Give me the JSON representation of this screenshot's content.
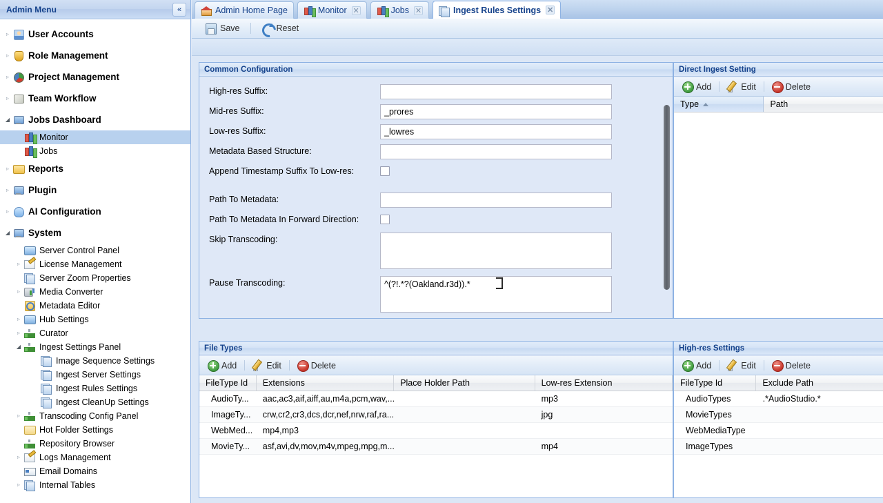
{
  "sidebar": {
    "title": "Admin Menu",
    "collapse_label": "«",
    "items": [
      {
        "label": "User Accounts",
        "icon": "user-icon",
        "level": "top",
        "state": "collapsed"
      },
      {
        "label": "Role Management",
        "icon": "shield-icon",
        "level": "top",
        "state": "collapsed"
      },
      {
        "label": "Project Management",
        "icon": "pie-chart-icon",
        "level": "top",
        "state": "collapsed"
      },
      {
        "label": "Team Workflow",
        "icon": "cube-icon",
        "level": "top",
        "state": "collapsed"
      },
      {
        "label": "Jobs Dashboard",
        "icon": "monitor-icon",
        "level": "top",
        "state": "expanded"
      },
      {
        "label": "Monitor",
        "icon": "bar-chart-icon",
        "level": "child",
        "state": "selected"
      },
      {
        "label": "Jobs",
        "icon": "bar-chart-icon",
        "level": "child",
        "state": "none"
      },
      {
        "label": "Reports",
        "icon": "folder-icon",
        "level": "top",
        "state": "collapsed"
      },
      {
        "label": "Plugin",
        "icon": "monitor-icon",
        "level": "top",
        "state": "collapsed"
      },
      {
        "label": "AI Configuration",
        "icon": "ai-icon",
        "level": "top",
        "state": "collapsed"
      },
      {
        "label": "System",
        "icon": "monitor-icon",
        "level": "top",
        "state": "expanded"
      },
      {
        "label": "Server Control Panel",
        "icon": "screen-icon",
        "level": "child",
        "state": "none"
      },
      {
        "label": "License Management",
        "icon": "pencil-icon",
        "level": "child",
        "state": "collapsed"
      },
      {
        "label": "Server Zoom Properties",
        "icon": "pages-icon",
        "level": "child",
        "state": "none"
      },
      {
        "label": "Media Converter",
        "icon": "drive-icon",
        "level": "child",
        "state": "collapsed"
      },
      {
        "label": "Metadata Editor",
        "icon": "metadata-icon",
        "level": "child",
        "state": "none"
      },
      {
        "label": "Hub Settings",
        "icon": "screen-icon",
        "level": "child",
        "state": "collapsed"
      },
      {
        "label": "Curator",
        "icon": "network-icon",
        "level": "child",
        "state": "collapsed"
      },
      {
        "label": "Ingest Settings Panel",
        "icon": "network-icon",
        "level": "child",
        "state": "expanded"
      },
      {
        "label": "Image Sequence Settings",
        "icon": "pages-icon",
        "level": "grandchild",
        "state": "none"
      },
      {
        "label": "Ingest Server Settings",
        "icon": "pages-icon",
        "level": "grandchild",
        "state": "none"
      },
      {
        "label": "Ingest Rules Settings",
        "icon": "pages-icon",
        "level": "grandchild",
        "state": "none"
      },
      {
        "label": "Ingest CleanUp Settings",
        "icon": "pages-icon",
        "level": "grandchild",
        "state": "none"
      },
      {
        "label": "Transcoding Config Panel",
        "icon": "network-icon",
        "level": "child",
        "state": "collapsed"
      },
      {
        "label": "Hot Folder Settings",
        "icon": "hot-folder-icon",
        "level": "child",
        "state": "none"
      },
      {
        "label": "Repository Browser",
        "icon": "network-icon",
        "level": "child",
        "state": "none"
      },
      {
        "label": "Logs Management",
        "icon": "pencil-icon",
        "level": "child",
        "state": "collapsed"
      },
      {
        "label": "Email Domains",
        "icon": "email-icon",
        "level": "child",
        "state": "none"
      },
      {
        "label": "Internal Tables",
        "icon": "pages-icon",
        "level": "child",
        "state": "collapsed"
      }
    ]
  },
  "tabs": [
    {
      "label": "Admin Home Page",
      "icon": "home-icon",
      "closable": false,
      "active": false
    },
    {
      "label": "Monitor",
      "icon": "bar-chart-icon",
      "closable": true,
      "active": false
    },
    {
      "label": "Jobs",
      "icon": "bar-chart-icon",
      "closable": true,
      "active": false
    },
    {
      "label": "Ingest Rules Settings",
      "icon": "pages-icon",
      "closable": true,
      "active": true
    }
  ],
  "tab_close_glyph": "✕",
  "toolbar": {
    "save_label": "Save",
    "reset_label": "Reset"
  },
  "common_configuration": {
    "title": "Common Configuration",
    "fields": [
      {
        "label": "High-res Suffix:",
        "value": "",
        "type": "text"
      },
      {
        "label": "Mid-res Suffix:",
        "value": "_prores",
        "type": "text"
      },
      {
        "label": "Low-res Suffix:",
        "value": "_lowres",
        "type": "text"
      },
      {
        "label": "Metadata Based Structure:",
        "value": "",
        "type": "text"
      },
      {
        "label": "Append Timestamp Suffix To Low-res:",
        "value": false,
        "type": "checkbox"
      },
      {
        "label": "Path To Metadata:",
        "value": "",
        "type": "text"
      },
      {
        "label": "Path To Metadata In Forward Direction:",
        "value": false,
        "type": "checkbox"
      },
      {
        "label": "Skip Transcoding:",
        "value": "",
        "type": "textarea"
      },
      {
        "label": "Pause Transcoding:",
        "value": "^(?!.*?(Oakland.r3d)).*",
        "type": "textarea"
      }
    ]
  },
  "direct_ingest_setting": {
    "title": "Direct Ingest Setting",
    "actions": [
      {
        "label": "Add",
        "icon": "add-icon"
      },
      {
        "label": "Edit",
        "icon": "edit-icon"
      },
      {
        "label": "Delete",
        "icon": "delete-icon"
      }
    ],
    "columns": [
      {
        "label": "Type",
        "sorted": true,
        "sort_dir": "asc"
      },
      {
        "label": "Path",
        "sorted": false
      }
    ],
    "rows": []
  },
  "file_types": {
    "title": "File Types",
    "actions": [
      {
        "label": "Add",
        "icon": "add-icon"
      },
      {
        "label": "Edit",
        "icon": "edit-icon"
      },
      {
        "label": "Delete",
        "icon": "delete-icon"
      }
    ],
    "columns": [
      "FileType Id",
      "Extensions",
      "Place Holder Path",
      "Low-res Extension"
    ],
    "rows": [
      {
        "filetype_id": "AudioTy...",
        "extensions": "aac,ac3,aif,aiff,au,m4a,pcm,wav,...",
        "place_holder_path": "",
        "lowres_extension": "mp3"
      },
      {
        "filetype_id": "ImageTy...",
        "extensions": "crw,cr2,cr3,dcs,dcr,nef,nrw,raf,ra...",
        "place_holder_path": "",
        "lowres_extension": "jpg"
      },
      {
        "filetype_id": "WebMed...",
        "extensions": "mp4,mp3",
        "place_holder_path": "",
        "lowres_extension": ""
      },
      {
        "filetype_id": "MovieTy...",
        "extensions": "asf,avi,dv,mov,m4v,mpeg,mpg,m...",
        "place_holder_path": "",
        "lowres_extension": "mp4"
      }
    ]
  },
  "highres_settings": {
    "title": "High-res Settings",
    "actions": [
      {
        "label": "Add",
        "icon": "add-icon"
      },
      {
        "label": "Edit",
        "icon": "edit-icon"
      },
      {
        "label": "Delete",
        "icon": "delete-icon"
      }
    ],
    "columns": [
      "FileType Id",
      "Exclude Path"
    ],
    "rows": [
      {
        "filetype_id": "AudioTypes",
        "exclude_path": ".*AudioStudio.*"
      },
      {
        "filetype_id": "MovieTypes",
        "exclude_path": ""
      },
      {
        "filetype_id": "WebMediaType",
        "exclude_path": ""
      },
      {
        "filetype_id": "ImageTypes",
        "exclude_path": ""
      }
    ]
  },
  "colors": {
    "accent": "#15428b",
    "panel_bg": "#dfe8f7",
    "border": "#8db2e3",
    "selection": "#b8d1ee"
  }
}
